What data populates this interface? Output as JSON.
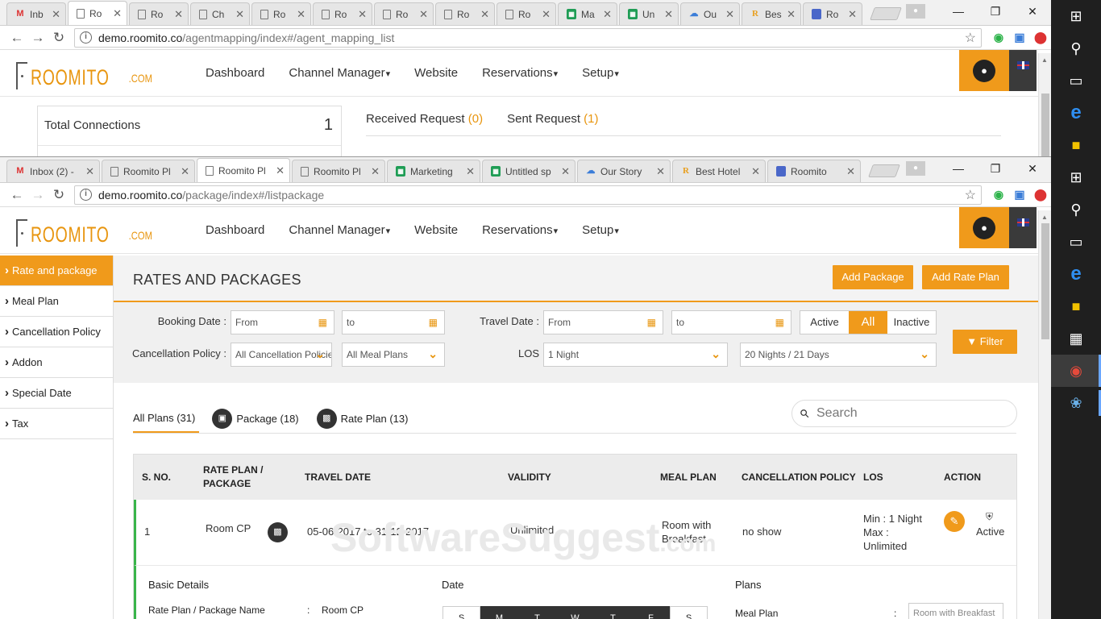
{
  "browser1": {
    "tabs": [
      {
        "icon": "gmail-icon",
        "title": "Inb"
      },
      {
        "icon": "roomito-page-icon",
        "title": "Ro"
      },
      {
        "icon": "roomito-page-icon",
        "title": "Ro"
      },
      {
        "icon": "roomito-page-icon",
        "title": "Ch"
      },
      {
        "icon": "roomito-page-icon",
        "title": "Ro"
      },
      {
        "icon": "roomito-page-icon",
        "title": "Ro"
      },
      {
        "icon": "roomito-page-icon",
        "title": "Ro"
      },
      {
        "icon": "roomito-page-icon",
        "title": "Ro"
      },
      {
        "icon": "roomito-page-icon",
        "title": "Ro"
      },
      {
        "icon": "sheets-icon",
        "title": "Ma"
      },
      {
        "icon": "sheets-icon",
        "title": "Un"
      },
      {
        "icon": "cloud-icon",
        "title": "Ou"
      },
      {
        "icon": "best-hotel-icon",
        "title": "Bes"
      },
      {
        "icon": "roomito-blue-icon",
        "title": "Ro"
      }
    ],
    "url_domain": "demo.roomito.co",
    "url_path": "/agentmapping/index#/agent_mapping_list"
  },
  "browser2": {
    "tabs": [
      {
        "icon": "gmail-icon",
        "title": "Inbox (2) -"
      },
      {
        "icon": "roomito-page-icon",
        "title": "Roomito Pl"
      },
      {
        "icon": "roomito-page-icon",
        "title": "Roomito Pl"
      },
      {
        "icon": "roomito-page-icon",
        "title": "Roomito Pl"
      },
      {
        "icon": "sheets-icon",
        "title": "Marketing"
      },
      {
        "icon": "sheets-icon",
        "title": "Untitled sp"
      },
      {
        "icon": "cloud-icon",
        "title": "Our Story"
      },
      {
        "icon": "best-hotel-icon",
        "title": "Best Hotel"
      },
      {
        "icon": "roomito-blue-icon",
        "title": "Roomito"
      }
    ],
    "url_domain": "demo.roomito.co",
    "url_path": "/package/index#/listpackage"
  },
  "logo": {
    "name": "ROOMITO",
    "suffix": ".COM"
  },
  "nav": {
    "dashboard": "Dashboard",
    "channel_manager": "Channel Manager",
    "website": "Website",
    "reservations": "Reservations",
    "setup": "Setup"
  },
  "agent_page": {
    "total_connections_label": "Total Connections",
    "total_connections_value": "1",
    "received_label": "Received Request",
    "received_count": "(0)",
    "sent_label": "Sent Request",
    "sent_count": "(1)"
  },
  "sidebar": {
    "items": [
      "Rate and package",
      "Meal Plan",
      "Cancellation Policy",
      "Addon",
      "Special Date",
      "Tax"
    ]
  },
  "header": {
    "title": "RATES AND PACKAGES",
    "add_package": "Add Package",
    "add_rate_plan": "Add Rate Plan"
  },
  "filters": {
    "booking_date_label": "Booking Date :",
    "booking_from": "From",
    "booking_to": "to",
    "travel_date_label": "Travel Date :",
    "travel_from": "From",
    "travel_to": "to",
    "status_active": "Active",
    "status_all": "All",
    "status_inactive": "Inactive",
    "filter_button": "Filter",
    "cancellation_label": "Cancellation Policy :",
    "cancellation_value": "All Cancellation Policies",
    "meal_value": "All Meal Plans",
    "los_label": "LOS",
    "los_value": "1 Night",
    "los_max_value": "20 Nights / 21 Days"
  },
  "plan_tabs": {
    "all": "All Plans (31)",
    "package": "Package (18)",
    "rate_plan": "Rate Plan (13)"
  },
  "search": {
    "placeholder": "Search"
  },
  "table": {
    "headers": {
      "sno": "S. NO.",
      "plan": "RATE PLAN / PACKAGE",
      "travel": "TRAVEL DATE",
      "validity": "VALIDITY",
      "meal": "MEAL PLAN",
      "cancel": "CANCELLATION POLICY",
      "los": "LOS",
      "action": "ACTION"
    },
    "row": {
      "sno": "1",
      "plan": "Room CP",
      "travel": "05-06-2017 to 31-12-2017",
      "validity": "Unlimited",
      "meal": "Room with Breakfast",
      "cancel": "no show",
      "los": "Min : 1 Night Max : Unlimited",
      "status": "Active"
    },
    "details": {
      "basic": "Basic Details",
      "date": "Date",
      "plans": "Plans",
      "name_label": "Rate Plan / Package Name",
      "name_colon": ":",
      "name_value": "Room CP",
      "meal_plan_label": "Meal Plan",
      "meal_colon": ":",
      "meal_select": "Room with Breakfast",
      "weekdays": [
        "S",
        "M",
        "T",
        "W",
        "T",
        "F",
        "S"
      ]
    }
  },
  "watermark": {
    "main": "SoftwareSuggest",
    "suffix": ".com"
  },
  "colors": {
    "accent": "#f09a1b",
    "active_row": "#39b54a",
    "dark": "#333333"
  }
}
